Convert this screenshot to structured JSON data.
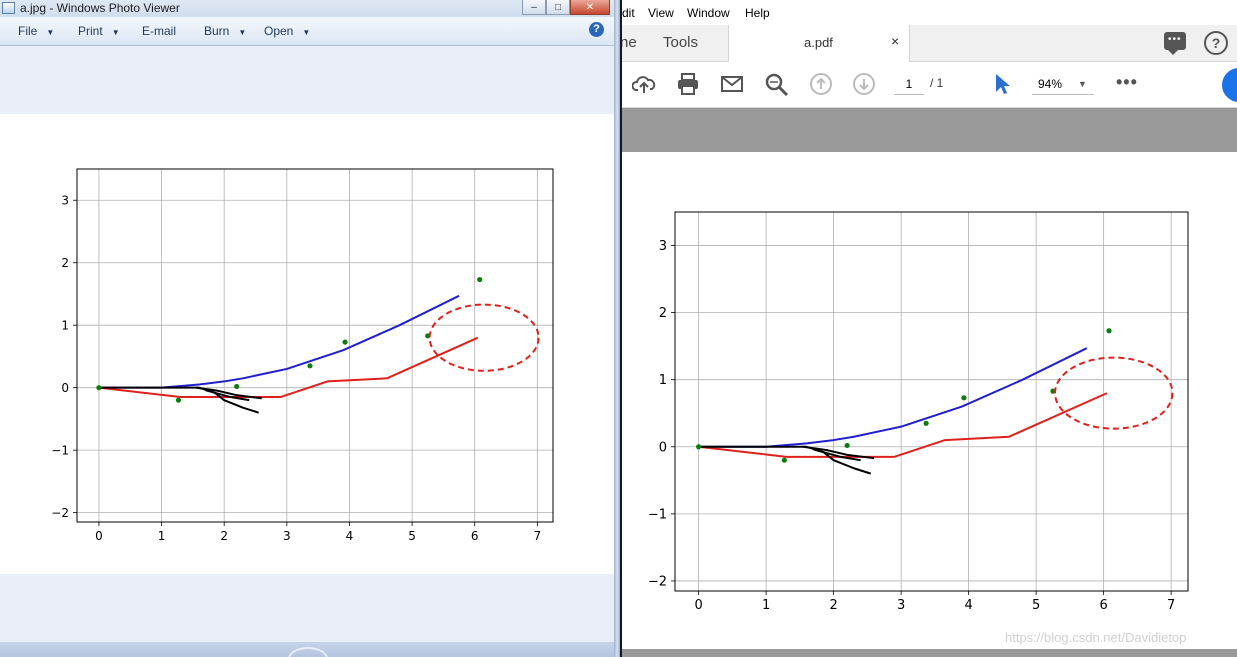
{
  "photo_viewer": {
    "title": "a.jpg - Windows Photo Viewer",
    "window_buttons": {
      "minimize": "–",
      "maximize": "□",
      "close": "✕"
    },
    "menu": [
      {
        "label": "File",
        "has_arrow": true
      },
      {
        "label": "Print",
        "has_arrow": true
      },
      {
        "label": "E-mail",
        "has_arrow": false
      },
      {
        "label": "Burn",
        "has_arrow": true
      },
      {
        "label": "Open",
        "has_arrow": true
      }
    ],
    "help_glyph": "?",
    "icons": [
      "help-icon",
      "photo-viewer-app-icon"
    ]
  },
  "pdf_reader": {
    "menu": [
      "dit",
      "View",
      "Window",
      "Help"
    ],
    "tabs": {
      "partial": "ne",
      "tools": "Tools",
      "document": "a.pdf",
      "close_glyph": "×"
    },
    "toolbar": {
      "page_current": "1",
      "page_total": "/ 1",
      "zoom": "94%",
      "more": "•••",
      "icons": [
        "upload-cloud-icon",
        "print-icon",
        "mail-icon",
        "zoom-search-icon",
        "page-up-icon",
        "page-down-icon",
        "select-cursor-icon",
        "comment-icon",
        "help-icon"
      ]
    },
    "help_glyph": "?",
    "watermark": "https://blog.csdn.net/Davidietop"
  },
  "chart_data": {
    "type": "line",
    "xlim": [
      -0.35,
      7.25
    ],
    "ylim": [
      -2.15,
      3.5
    ],
    "xticks": [
      0,
      1,
      2,
      3,
      4,
      5,
      6,
      7
    ],
    "yticks": [
      -2,
      -1,
      0,
      1,
      2,
      3
    ],
    "xtick_labels": [
      "0",
      "1",
      "2",
      "3",
      "4",
      "5",
      "6",
      "7"
    ],
    "ytick_labels": [
      "−2",
      "−1",
      "0",
      "1",
      "2",
      "3"
    ],
    "grid": true,
    "colors": {
      "blue": "#1f1fcf",
      "red": "#e0201b",
      "black": "#000000",
      "green": "#0a7d0a"
    },
    "series": [
      {
        "color": "blue",
        "style": "solid",
        "x": [
          0,
          1,
          1.6,
          2.0,
          2.3,
          3.0,
          3.9,
          4.8,
          5.75
        ],
        "y": [
          0,
          0,
          0.05,
          0.1,
          0.15,
          0.3,
          0.6,
          1.0,
          1.47
        ]
      },
      {
        "color": "red",
        "style": "solid",
        "x": [
          0,
          1.3,
          2.0,
          2.9,
          3.65,
          4.6,
          6.05
        ],
        "y": [
          0,
          -0.15,
          -0.15,
          -0.15,
          0.1,
          0.15,
          0.8
        ]
      },
      {
        "color": "black",
        "style": "solid",
        "x": [
          0,
          1.6,
          1.85,
          2.0,
          2.3,
          2.55
        ],
        "y": [
          0,
          0,
          -0.08,
          -0.2,
          -0.32,
          -0.4
        ]
      },
      {
        "color": "black",
        "style": "solid",
        "x": [
          1.55,
          1.9,
          2.2,
          2.6
        ],
        "y": [
          0,
          -0.05,
          -0.12,
          -0.17
        ]
      },
      {
        "color": "black",
        "style": "solid",
        "x": [
          1.7,
          2.1,
          2.4
        ],
        "y": [
          -0.04,
          -0.15,
          -0.2
        ]
      }
    ],
    "scatter": {
      "color": "green",
      "x": [
        0,
        1.27,
        2.2,
        3.37,
        3.93,
        5.25,
        6.08
      ],
      "y": [
        0,
        -0.2,
        0.02,
        0.35,
        0.73,
        0.83,
        1.73
      ]
    },
    "ellipse": {
      "color": "red",
      "style": "dashed",
      "cx": 6.15,
      "cy": 0.8,
      "rx": 0.87,
      "ry": 0.53
    }
  }
}
